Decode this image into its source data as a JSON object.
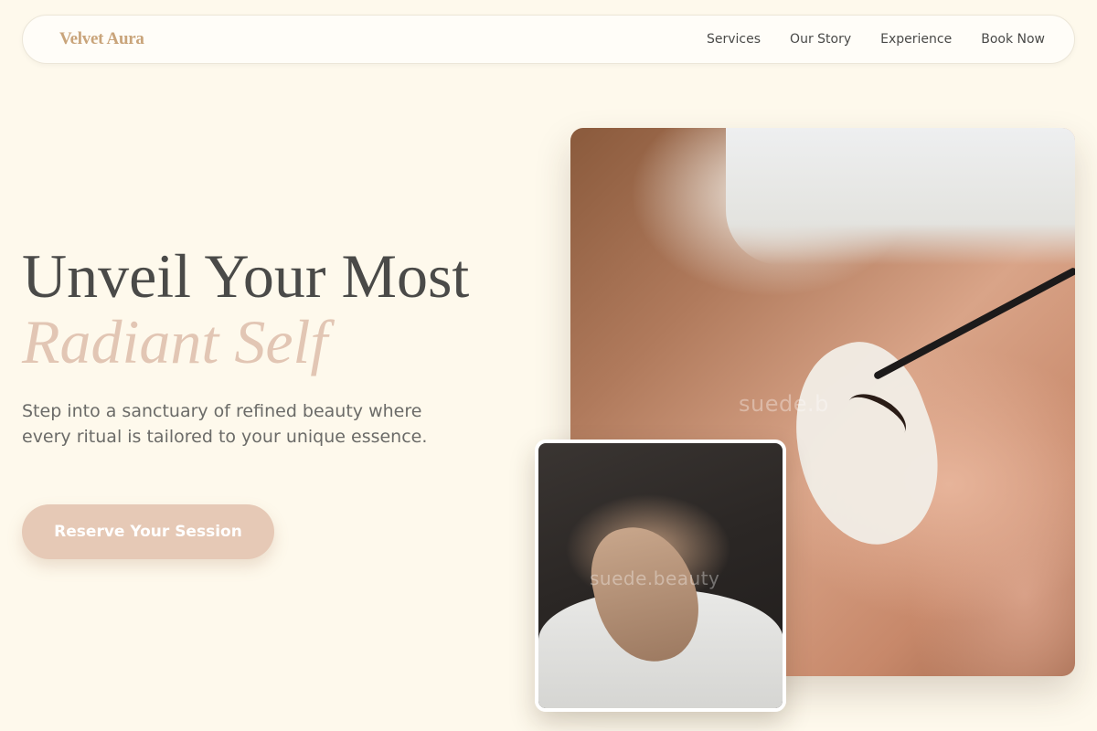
{
  "nav": {
    "brand": "Velvet Aura",
    "links": [
      {
        "label": "Services"
      },
      {
        "label": "Our Story"
      },
      {
        "label": "Experience"
      },
      {
        "label": "Book Now"
      }
    ]
  },
  "hero": {
    "headline_line1": "Unveil Your Most",
    "headline_line2": "Radiant Self",
    "subtext": "Step into a sanctuary of refined beauty where every ritual is tailored to your unique essence.",
    "cta_label": "Reserve Your Session"
  },
  "images": {
    "main_watermark": "suede.b",
    "small_watermark": "suede.beauty"
  },
  "colors": {
    "background": "#fef9ec",
    "brand": "#c9a47a",
    "accent": "#e2c6b4",
    "cta_background": "#e6c9b6",
    "text": "#4a4a48"
  }
}
